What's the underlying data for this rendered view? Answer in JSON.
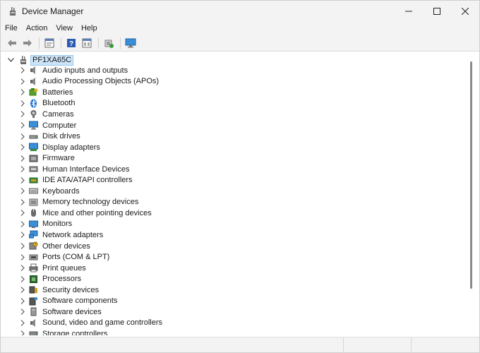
{
  "window": {
    "title": "Device Manager",
    "icon": "device-manager-icon",
    "controls": [
      "minimize-icon",
      "maximize-icon",
      "close-icon"
    ]
  },
  "menu": [
    "File",
    "Action",
    "View",
    "Help"
  ],
  "toolbar": [
    "back-icon",
    "forward-icon",
    "properties-icon",
    "help-icon",
    "details-icon",
    "update-driver-icon",
    "monitor-icon"
  ],
  "tree": {
    "root": {
      "label": "PF1XA65C",
      "expanded": true,
      "selected": true
    },
    "items": [
      {
        "label": "Audio inputs and outputs",
        "icon": "speaker-icon"
      },
      {
        "label": "Audio Processing Objects (APOs)",
        "icon": "speaker-icon"
      },
      {
        "label": "Batteries",
        "icon": "battery-icon"
      },
      {
        "label": "Bluetooth",
        "icon": "bluetooth-icon"
      },
      {
        "label": "Cameras",
        "icon": "camera-icon"
      },
      {
        "label": "Computer",
        "icon": "computer-icon"
      },
      {
        "label": "Disk drives",
        "icon": "disk-drive-icon"
      },
      {
        "label": "Display adapters",
        "icon": "display-adapter-icon"
      },
      {
        "label": "Firmware",
        "icon": "firmware-icon"
      },
      {
        "label": "Human Interface Devices",
        "icon": "hid-icon"
      },
      {
        "label": "IDE ATA/ATAPI controllers",
        "icon": "ide-controller-icon"
      },
      {
        "label": "Keyboards",
        "icon": "keyboard-icon"
      },
      {
        "label": "Memory technology devices",
        "icon": "memory-icon"
      },
      {
        "label": "Mice and other pointing devices",
        "icon": "mouse-icon"
      },
      {
        "label": "Monitors",
        "icon": "monitor-icon"
      },
      {
        "label": "Network adapters",
        "icon": "network-adapter-icon"
      },
      {
        "label": "Other devices",
        "icon": "unknown-device-icon"
      },
      {
        "label": "Ports (COM & LPT)",
        "icon": "port-icon"
      },
      {
        "label": "Print queues",
        "icon": "printer-icon"
      },
      {
        "label": "Processors",
        "icon": "processor-icon"
      },
      {
        "label": "Security devices",
        "icon": "security-device-icon"
      },
      {
        "label": "Software components",
        "icon": "software-component-icon"
      },
      {
        "label": "Software devices",
        "icon": "software-device-icon"
      },
      {
        "label": "Sound, video and game controllers",
        "icon": "sound-icon"
      },
      {
        "label": "Storage controllers",
        "icon": "storage-controller-icon"
      }
    ]
  },
  "colors": {
    "selection_bg": "#cce4f7",
    "selection_border": "#99c9ef",
    "chrome_bg": "#f3f3f3"
  }
}
